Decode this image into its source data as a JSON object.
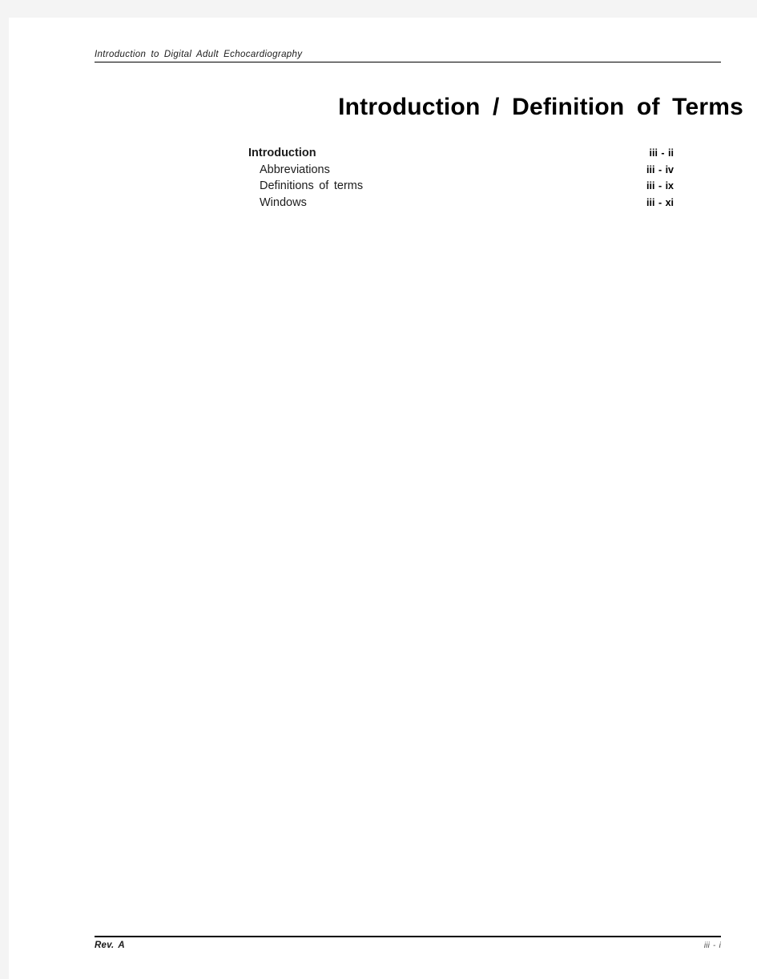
{
  "document": {
    "running_header": "Introduction  to  Digital  Adult  Echocardiography",
    "chapter_title": "Introduction / Definition of Terms",
    "toc": {
      "entries": [
        {
          "label": "Introduction",
          "page": "iii - ii",
          "level": 1
        },
        {
          "label": "Abbreviations",
          "page": "iii - iv",
          "level": 2
        },
        {
          "label": "Definitions of terms",
          "page": "iii - ix",
          "level": 2
        },
        {
          "label": "Windows",
          "page": "iii - xi",
          "level": 2
        }
      ]
    },
    "running_footer": {
      "revision": "Rev. A",
      "page_number": "iii - i"
    }
  },
  "colors": {
    "page_background": "#ffffff",
    "canvas_background": "#f4f4f4",
    "text": "#1c1c1c",
    "rule": "#000000"
  }
}
